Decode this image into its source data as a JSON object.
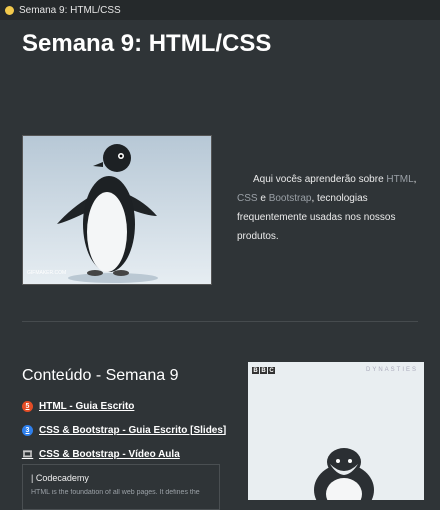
{
  "tab": {
    "title": "Semana 9: HTML/CSS"
  },
  "page": {
    "title": "Semana 9: HTML/CSS"
  },
  "intro": {
    "prefix": "Aqui vocês aprenderão sobre ",
    "html": "HTML",
    "sep1": ", ",
    "css": "CSS",
    "and": " e ",
    "bootstrap": "Bootstrap",
    "suffix": ", tecnologias frequentemente usadas nos nossos produtos."
  },
  "gif": {
    "watermark": "GIFMAKER.COM"
  },
  "content": {
    "title": "Conteúdo - Semana 9",
    "items": [
      {
        "label": "HTML - Guia Escrito",
        "icon": "html5-icon",
        "badge": "5"
      },
      {
        "label": "CSS & Bootstrap - Guia Escrito [Slides]",
        "icon": "css3-icon",
        "badge": "3"
      },
      {
        "label": "CSS & Bootstrap - Vídeo Aula",
        "icon": "film-icon",
        "badge": "🎞"
      }
    ]
  },
  "bookmark": {
    "title": "| Codecademy",
    "description": "HTML is the foundation of all web pages. It defines the"
  },
  "video": {
    "brand": [
      "B",
      "B",
      "C"
    ],
    "series": "DYNASTIES"
  },
  "colors": {
    "background": "#2f3437",
    "accent_link": "#9aa0a6",
    "html_icon": "#e44d26",
    "css_icon": "#2f80ed"
  }
}
